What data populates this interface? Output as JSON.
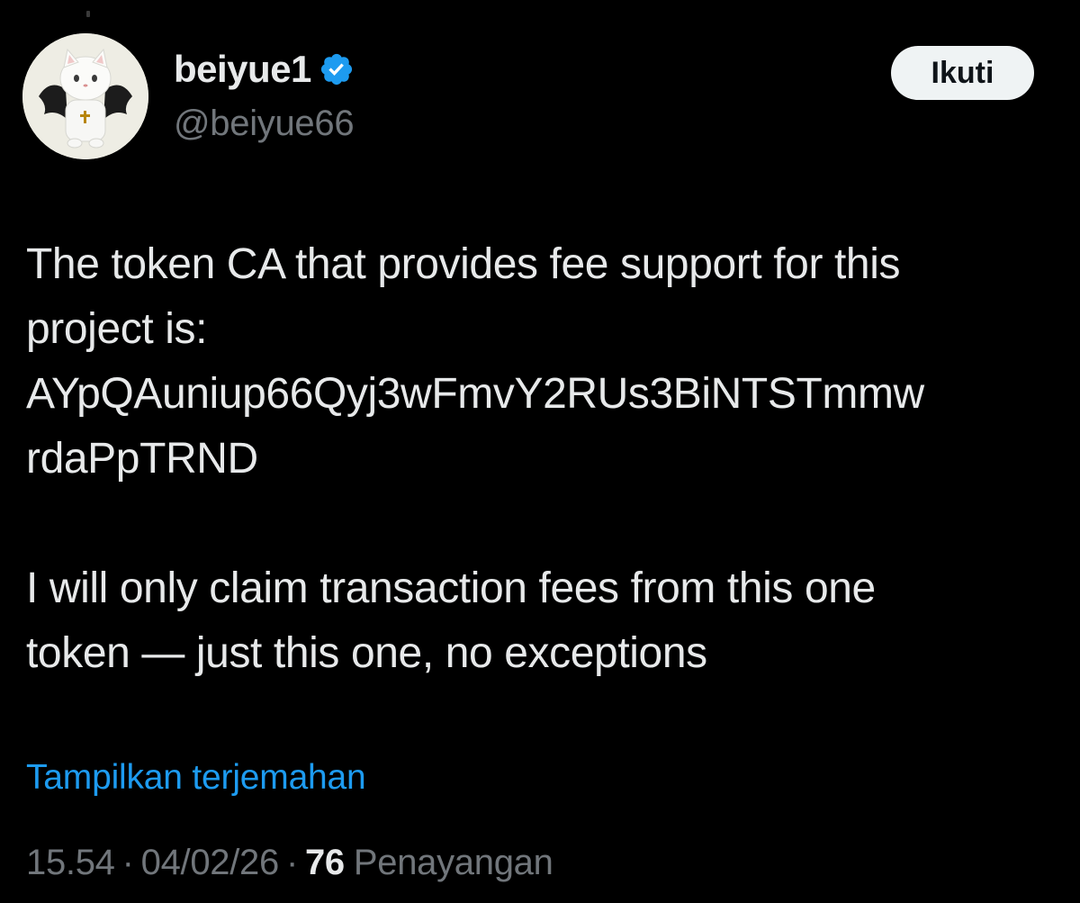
{
  "tweet": {
    "author": {
      "display_name": "beiyue1",
      "handle": "@beiyue66",
      "verified": true,
      "verified_icon": "verified-badge-icon",
      "avatar": "cat-plush-avatar"
    },
    "follow_label": "Ikuti",
    "body": {
      "paragraph1_lines": [
        "The token CA that provides fee support for this",
        "project is:",
        "AYpQAuniup66Qyj3wFmvY2RUs3BiNTSTmmw",
        "rdaPpTRND"
      ],
      "paragraph2_lines": [
        "I will only claim transaction fees from this one",
        "token — just this one, no exceptions"
      ]
    },
    "translate_label": "Tampilkan terjemahan",
    "meta": {
      "time": "15.54",
      "date": "04/02/26",
      "separator": "·",
      "views_count": "76",
      "views_label": "Penayangan"
    }
  },
  "colors": {
    "background": "#000000",
    "primary_text": "#e7e9ea",
    "secondary_text": "#71767b",
    "link": "#1d9bf0",
    "follow_button_bg": "#eff3f4"
  }
}
